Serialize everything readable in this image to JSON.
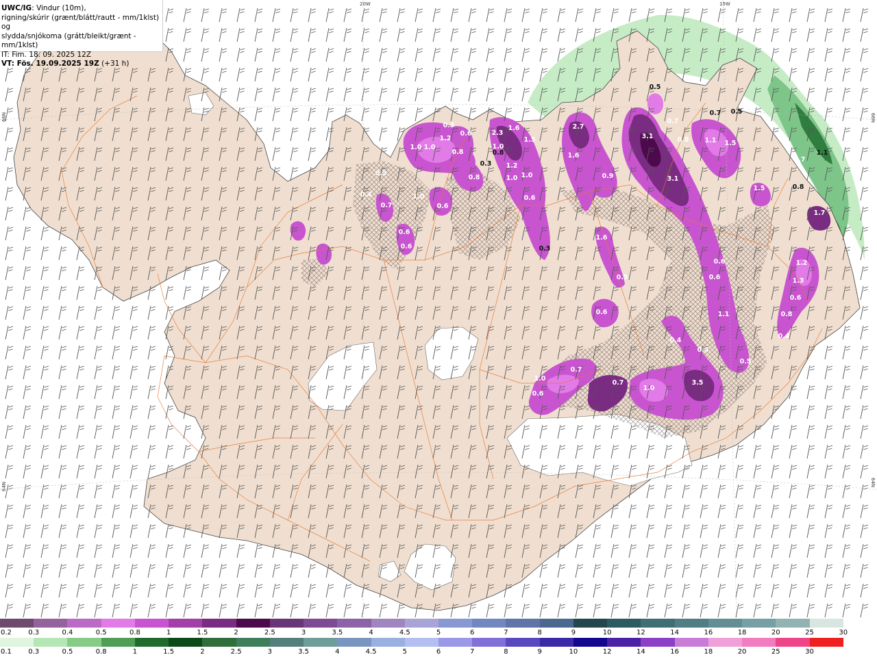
{
  "info": {
    "title": "UWC/IG",
    "title_rest": ": Vindur (10m),",
    "line2": "rigning/skúrir (grænt/blátt/rautt - mm/1klst) og",
    "line3": "slydda/snjókoma (grátt/bleikt/grænt - mm/1klst)",
    "line4": "IT: Fim. 18. 09. 2025 12Z",
    "vt_label": "VT: Fös. 19.09.2025 19Z",
    "vt_extra": " (+31 h)"
  },
  "grid_labels": {
    "lon_20w": "20W",
    "lon_15w": "15W",
    "lat_66n_left": "66N",
    "lat_66n_right": "66N",
    "lat_64n_left": "64N",
    "lat_64n_right": "64N"
  },
  "colors": {
    "sea": "#ffffff",
    "land": "#f0dfd0",
    "glacier": "#ffffff",
    "roads": "#e8742f",
    "coast": "#444444",
    "barb": "#555555"
  },
  "snow_scale": {
    "labels": [
      "0.2",
      "0.3",
      "0.4",
      "0.5",
      "0.8",
      "1",
      "1.5",
      "2",
      "2.5",
      "3",
      "3.5",
      "4",
      "4.5",
      "5",
      "6",
      "7",
      "8",
      "9",
      "10",
      "12",
      "14",
      "16",
      "18",
      "20",
      "25",
      "30"
    ],
    "colors": [
      "#6e4a6e",
      "#94639c",
      "#bb6bc6",
      "#e27be8",
      "#c855cf",
      "#a240a8",
      "#7a2b82",
      "#4c0a4c",
      "#6a3578",
      "#7e4a92",
      "#8c63a6",
      "#9f86c0",
      "#a8a4d8",
      "#8898d0",
      "#7286c0",
      "#6074a8",
      "#4c6890",
      "#22484e",
      "#2c5c62",
      "#3f6e74",
      "#507e84",
      "#628e94",
      "#76a0a4",
      "#93b2b2",
      "#d8e6e2"
    ]
  },
  "rain_scale": {
    "labels": [
      "0.1",
      "0.3",
      "0.5",
      "0.8",
      "1",
      "1.5",
      "2",
      "2.5",
      "3",
      "3.5",
      "4",
      "4.5",
      "5",
      "6",
      "7",
      "8",
      "9",
      "10",
      "12",
      "14",
      "16",
      "18",
      "20",
      "25",
      "30"
    ],
    "colors": [
      "#dff5df",
      "#b5e6b5",
      "#86cc86",
      "#4f9e55",
      "#1f6b2e",
      "#0d4a1a",
      "#2f6e3a",
      "#3e7e5a",
      "#557f7c",
      "#6e9e9a",
      "#7a96c0",
      "#9ab0e0",
      "#b2bff0",
      "#9c98e8",
      "#8070d8",
      "#5a48c0",
      "#3a2aa8",
      "#12078e",
      "#4a22a8",
      "#8c40c8",
      "#c87cd8",
      "#f0a0d8",
      "#f27cc0",
      "#ee4488",
      "#ee2020"
    ]
  },
  "precip_labels": [
    {
      "v": "0.5"
    },
    {
      "v": "1.0"
    },
    {
      "v": "1.0"
    },
    {
      "v": "1.2"
    },
    {
      "v": "0.8"
    },
    {
      "v": "0.3"
    },
    {
      "v": "0.8"
    },
    {
      "v": "0.5"
    },
    {
      "v": "0.4"
    },
    {
      "v": "0.7"
    },
    {
      "v": "0.6"
    },
    {
      "v": "0.6"
    },
    {
      "v": "1.0"
    },
    {
      "v": "0.6"
    },
    {
      "v": "0.6"
    },
    {
      "v": "1.0"
    },
    {
      "v": "2.3"
    },
    {
      "v": "1.6"
    },
    {
      "v": "1.5"
    },
    {
      "v": "1.2"
    },
    {
      "v": "1.0"
    },
    {
      "v": "1.0"
    },
    {
      "v": "0.6"
    },
    {
      "v": "2.7"
    },
    {
      "v": "1.6"
    },
    {
      "v": "0.9"
    },
    {
      "v": "3.1"
    },
    {
      "v": "3.1"
    },
    {
      "v": "0.8"
    },
    {
      "v": "1.1"
    },
    {
      "v": "1.5"
    },
    {
      "v": "0.5"
    },
    {
      "v": "0.7"
    },
    {
      "v": "1.5"
    },
    {
      "v": "1.6"
    },
    {
      "v": "0.5"
    },
    {
      "v": "0.6"
    },
    {
      "v": "0.6"
    },
    {
      "v": "1.1"
    },
    {
      "v": "0.6"
    },
    {
      "v": "0.4"
    },
    {
      "v": "0.4"
    },
    {
      "v": "3.5"
    },
    {
      "v": "1.0"
    },
    {
      "v": "0.7"
    },
    {
      "v": "1.0"
    },
    {
      "v": "0.7"
    },
    {
      "v": "0.6"
    },
    {
      "v": "0.5"
    },
    {
      "v": "1.2"
    },
    {
      "v": "1.3"
    },
    {
      "v": "0.8"
    },
    {
      "v": "0.4"
    },
    {
      "v": "1.7"
    },
    {
      "v": "0.7"
    },
    {
      "v": "0.8"
    },
    {
      "v": "0.8"
    },
    {
      "v": "1.1"
    },
    {
      "v": "0.6"
    },
    {
      "v": "0.5"
    },
    {
      "v": "0.7"
    },
    {
      "v": "0.3"
    }
  ]
}
